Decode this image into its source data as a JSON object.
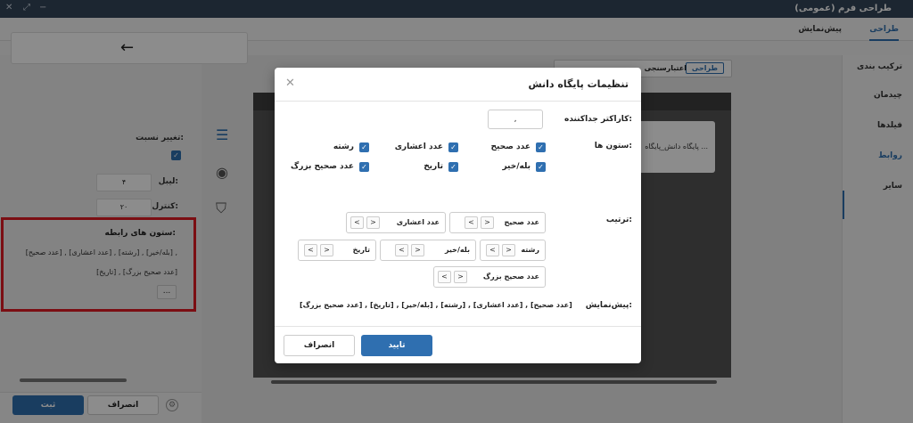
{
  "window": {
    "title": "طراحی فرم (عمومی)",
    "min_icon": "−",
    "max_icon": "⤢",
    "close_icon": "✕"
  },
  "tabs": {
    "design": "طراحی",
    "preview": "پیش‌نمایش"
  },
  "right_nav": {
    "items": [
      "ترکیب بندی",
      "چیدمان",
      "فیلدها",
      "روابط",
      "سایر"
    ],
    "active": "روابط"
  },
  "canvas": {
    "toggle_design": "طراحی",
    "toggle_validation": "اعتبارسنجی",
    "card_text": "پایگاه دانش_پایگاه ..."
  },
  "left_panel": {
    "change_ratio_label": "تغییر نسبت:",
    "label_label": "لیبل:",
    "label_value": "۴",
    "control_label": "کنترل:",
    "control_value": "۲۰",
    "relation_columns_title": "ستون های رابطه:",
    "relation_columns_line1": "[عدد صحیح] , [عدد اعشاری] , [رشته] , [بله/خیر] ,",
    "relation_columns_line2": "[تاریخ] , [عدد صحیح بزرگ]",
    "more_button": "...",
    "save_button": "ثبت",
    "cancel_button": "انصراف"
  },
  "modal": {
    "title": "تنظیمات پایگاه دانش",
    "close": "✕",
    "separator_label": "کاراکتر جداکننده:",
    "separator_value": ",",
    "columns_label": "ستون ها:",
    "columns": [
      {
        "label": "عدد صحیح",
        "checked": true
      },
      {
        "label": "عدد اعشاری",
        "checked": true
      },
      {
        "label": "رشته",
        "checked": true
      },
      {
        "label": "بله/خیر",
        "checked": true
      },
      {
        "label": "تاریخ",
        "checked": true
      },
      {
        "label": "عدد صحیح بزرگ",
        "checked": true
      }
    ],
    "order_label": "ترتیب:",
    "order_items": [
      "عدد صحیح",
      "عدد اعشاری",
      "رشته",
      "بله/خیر",
      "تاریخ",
      "عدد صحیح بزرگ"
    ],
    "order_prev": "<",
    "order_next": ">",
    "preview_label": "پیش‌نمایش:",
    "preview_value": "[عدد صحیح] , [عدد اعشاری] , [رشته] , [بله/خیر] , [تاریخ] , [عدد صحیح بزرگ]",
    "confirm_button": "تایید",
    "cancel_button": "انصراف"
  },
  "colors": {
    "accent": "#2f6fb0",
    "highlight": "#e01b24",
    "titlebar": "#33455a"
  }
}
